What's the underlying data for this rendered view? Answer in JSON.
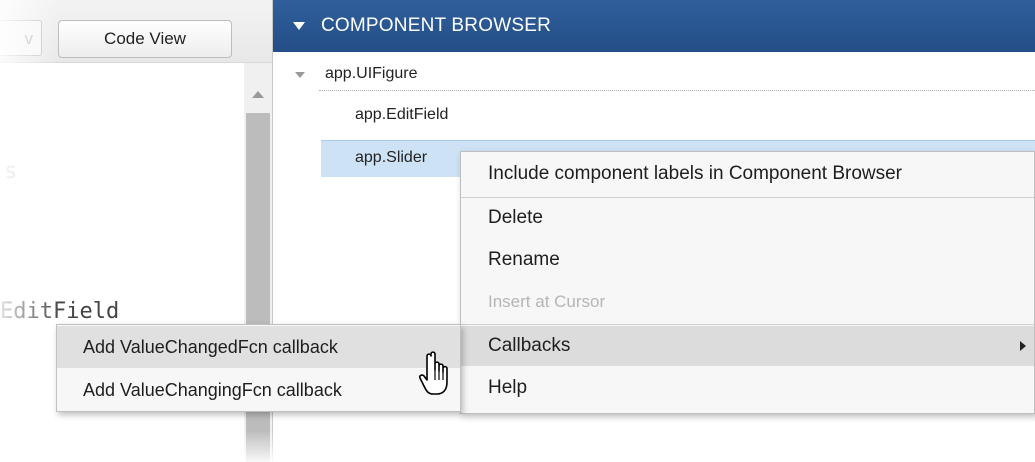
{
  "left_pane": {
    "tab_design_fragment": "v",
    "tab_code_label": "Code View",
    "code_fragment_s": "s",
    "code_fragment_line": "EditField"
  },
  "component_browser": {
    "title": "COMPONENT BROWSER",
    "tree": {
      "root": "app.UIFigure",
      "children": [
        "app.EditField",
        "app.Slider"
      ]
    },
    "selected": "app.Slider"
  },
  "context_menu": {
    "items": [
      {
        "label": "Include component labels in Component Browser",
        "enabled": true
      },
      {
        "label": "Delete",
        "enabled": true
      },
      {
        "label": "Rename",
        "enabled": true
      },
      {
        "label": "Insert at Cursor",
        "enabled": false
      },
      {
        "label": "Callbacks",
        "enabled": true,
        "has_submenu": true
      },
      {
        "label": "Help",
        "enabled": true
      }
    ],
    "active_item": "Callbacks"
  },
  "submenu": {
    "items": [
      {
        "label": "Add ValueChangedFcn callback"
      },
      {
        "label": "Add ValueChangingFcn callback"
      }
    ],
    "hovered_item": "Add ValueChangedFcn callback"
  },
  "icons": {
    "header_toggle": "caret-down-icon",
    "tree_toggle": "caret-down-icon",
    "submenu_indicator": "chevron-right-icon",
    "cursor": "hand-pointer-icon"
  },
  "colors": {
    "header_bg": "#2a5790",
    "selection_bg": "#cde3f5",
    "menu_hover_bg": "#dcdcdc"
  }
}
